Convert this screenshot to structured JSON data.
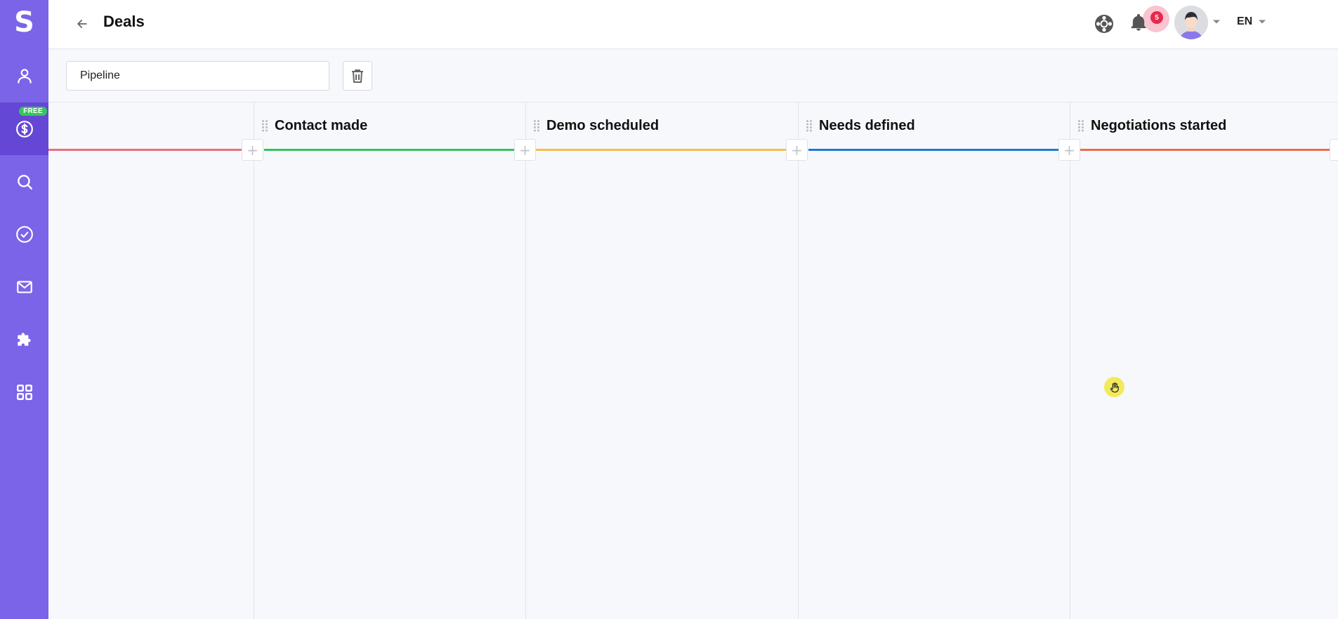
{
  "app": {
    "logo_letter": "S"
  },
  "sidebar": {
    "items": [
      {
        "icon": "user-icon",
        "active": false
      },
      {
        "icon": "dollar-icon",
        "active": true,
        "badge": "FREE"
      },
      {
        "icon": "search-icon",
        "active": false
      },
      {
        "icon": "check-circle-icon",
        "active": false
      },
      {
        "icon": "mail-icon",
        "active": false
      },
      {
        "icon": "puzzle-icon",
        "active": false
      },
      {
        "icon": "grid-icon",
        "active": false
      }
    ]
  },
  "header": {
    "title": "Deals",
    "notification_count": "5",
    "language": "EN"
  },
  "toolbar": {
    "pipeline_name": "Pipeline"
  },
  "stages": [
    {
      "name": "",
      "color": "#e8707f"
    },
    {
      "name": "Contact made",
      "color": "#35c25d"
    },
    {
      "name": "Demo scheduled",
      "color": "#f7be4b"
    },
    {
      "name": "Needs defined",
      "color": "#1f7bd1"
    },
    {
      "name": "Negotiations started",
      "color": "#ea6b52"
    }
  ],
  "colors": {
    "sidebar": "#7b64e8",
    "sidebar_active": "#6547d6",
    "free_badge": "#34c759",
    "notification": "#e5294b"
  }
}
